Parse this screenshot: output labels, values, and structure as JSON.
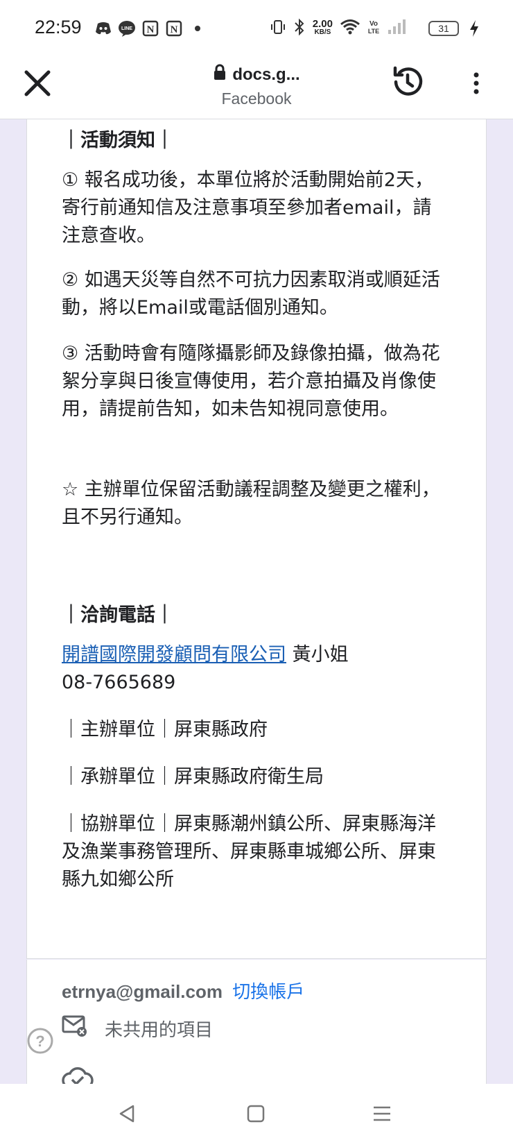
{
  "status_bar": {
    "time": "22:59",
    "net_speed_value": "2.00",
    "net_speed_unit": "KB/S",
    "battery": "31",
    "icons": [
      "discord-icon",
      "line-icon",
      "notion-icon",
      "notion-icon",
      "dot-icon",
      "vibrate-icon",
      "bluetooth-icon",
      "wifi-icon",
      "volte-icon",
      "signal-icon",
      "battery-icon",
      "charging-icon"
    ]
  },
  "browser": {
    "url": "docs.g...",
    "subtitle": "Facebook"
  },
  "content": {
    "notice_title": "｜活動須知｜",
    "notice_1": "① 報名成功後，本單位將於活動開始前2天，寄行前通知信及注意事項至參加者email，請注意查收。",
    "notice_2": "② 如遇天災等自然不可抗力因素取消或順延活動，將以Email或電話個別通知。",
    "notice_3": "③ 活動時會有隨隊攝影師及錄像拍攝，做為花絮分享與日後宣傳使用，若介意拍攝及肖像使用，請提前告知，如未告知視同意使用。",
    "notice_star": "☆ 主辦單位保留活動議程調整及變更之權利，且不另行通知。",
    "contact_title": "｜洽詢電話｜",
    "contact_company": "開譜國際開發顧問有限公司",
    "contact_person": " 黃小姐",
    "contact_phone": "08-7665689",
    "organizer": "｜主辦單位｜屏東縣政府",
    "executor": "｜承辦單位｜屏東縣政府衛生局",
    "co_organizers": "｜協辦單位｜屏東縣潮州鎮公所、屏東縣海洋及漁業事務管理所、屏東縣車城鄉公所、屏東縣九如鄉公所"
  },
  "footer": {
    "email": "etrnya@gmail.com",
    "switch_account": "切換帳戶",
    "unshared_items": "未共用的項目"
  },
  "colors": {
    "link": "#1a5fb4",
    "accent": "#1a73e8",
    "page_bg": "#ebe8f7"
  }
}
